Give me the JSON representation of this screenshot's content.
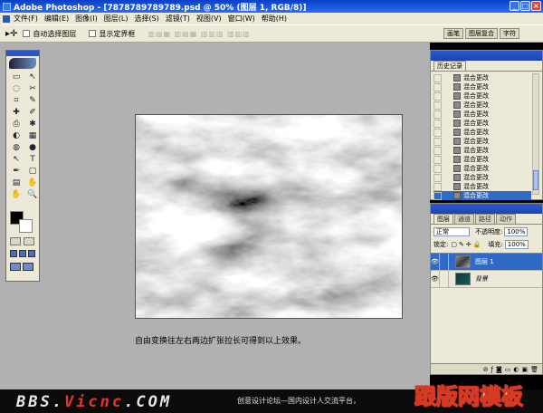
{
  "window": {
    "title": "Adobe Photoshop - [7878789789789.psd @ 50% (图层 1, RGB/8)]",
    "min": "_",
    "max": "□",
    "close": "×"
  },
  "menu": [
    "文件(F)",
    "编辑(E)",
    "图像(I)",
    "图层(L)",
    "选择(S)",
    "滤镜(T)",
    "视图(V)",
    "窗口(W)",
    "帮助(H)"
  ],
  "options": {
    "auto_select": "自动选择图层",
    "show_bounds": "显示定界框"
  },
  "well_tabs": [
    "画笔",
    "图层复合",
    "字符"
  ],
  "toolbox": {
    "tools": [
      "▭",
      "↖",
      "◌",
      "✂",
      "⌗",
      "✎",
      "✚",
      "✐",
      "⎙",
      "✱",
      "◐",
      "▦",
      "◍",
      "●",
      "↖",
      "T",
      "✒",
      "▢",
      "▤",
      "✋",
      "✋",
      "🔍"
    ]
  },
  "caption": "自由变换往左右两边扩张拉长可得到以上效果。",
  "history": {
    "tab": "历史记录",
    "item_label": "混合更改",
    "count": 14,
    "selected_index": 13
  },
  "layers": {
    "tabs": [
      "图层",
      "通道",
      "路径",
      "动作"
    ],
    "blend_mode": "正常",
    "opacity_label": "不透明度:",
    "opacity": "100%",
    "lock_label": "锁定:",
    "fill_label": "填充:",
    "fill": "100%",
    "items": [
      {
        "name": "图层 1",
        "selected": true
      },
      {
        "name": "背景",
        "selected": false
      }
    ]
  },
  "watermark": {
    "bbs_prefix": "BBS.",
    "bbs_red": "Vicnc",
    "bbs_suffix": ".COM",
    "slogan": "创意设计论坛—国内设计人交流平台，",
    "brand": "跟版网模板"
  },
  "colors": {
    "title_blue": "#1c52d8",
    "workspace": "#b2b1b1",
    "panel": "#ece9d8",
    "selection": "#316ac5",
    "brand_red": "#d53a24"
  }
}
